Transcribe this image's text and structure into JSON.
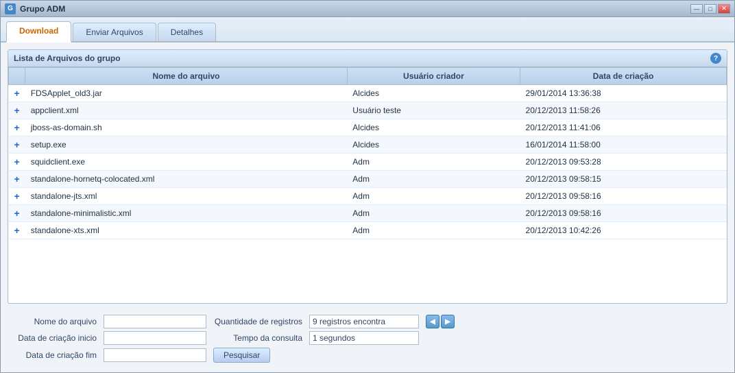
{
  "window": {
    "title": "Grupo ADM",
    "icon": "G"
  },
  "title_controls": {
    "minimize": "—",
    "maximize": "□",
    "close": "✕"
  },
  "tabs": [
    {
      "id": "download",
      "label": "Download",
      "active": true
    },
    {
      "id": "enviar",
      "label": "Enviar Arquivos",
      "active": false
    },
    {
      "id": "detalhes",
      "label": "Detalhes",
      "active": false
    }
  ],
  "panel": {
    "title": "Lista de Arquivos do grupo",
    "help": "?"
  },
  "table": {
    "headers": [
      "",
      "Nome do arquivo",
      "Usuário criador",
      "Data de criação"
    ],
    "rows": [
      {
        "add": "+",
        "filename": "FDSApplet_old3.jar",
        "user": "Alcides",
        "date": "29/01/2014 13:36:38"
      },
      {
        "add": "+",
        "filename": "appclient.xml",
        "user": "Usuário teste",
        "date": "20/12/2013 11:58:26"
      },
      {
        "add": "+",
        "filename": "jboss-as-domain.sh",
        "user": "Alcides",
        "date": "20/12/2013 11:41:06"
      },
      {
        "add": "+",
        "filename": "setup.exe",
        "user": "Alcides",
        "date": "16/01/2014 11:58:00"
      },
      {
        "add": "+",
        "filename": "squidclient.exe",
        "user": "Adm",
        "date": "20/12/2013 09:53:28"
      },
      {
        "add": "+",
        "filename": "standalone-hornetq-colocated.xml",
        "user": "Adm",
        "date": "20/12/2013 09:58:15"
      },
      {
        "add": "+",
        "filename": "standalone-jts.xml",
        "user": "Adm",
        "date": "20/12/2013 09:58:16"
      },
      {
        "add": "+",
        "filename": "standalone-minimalistic.xml",
        "user": "Adm",
        "date": "20/12/2013 09:58:16"
      },
      {
        "add": "+",
        "filename": "standalone-xts.xml",
        "user": "Adm",
        "date": "20/12/2013 10:42:26"
      }
    ]
  },
  "form": {
    "nome_label": "Nome do arquivo",
    "nome_placeholder": "",
    "data_inicio_label": "Data de criação inicio",
    "data_inicio_placeholder": "",
    "data_fim_label": "Data de criação fim",
    "data_fim_placeholder": "",
    "quantidade_label": "Quantidade de registros",
    "quantidade_value": "9 registros encontra",
    "tempo_label": "Tempo da consulta",
    "tempo_value": "1 segundos",
    "search_btn": "Pesquisar",
    "nav_prev": "◀",
    "nav_next": "▶"
  }
}
